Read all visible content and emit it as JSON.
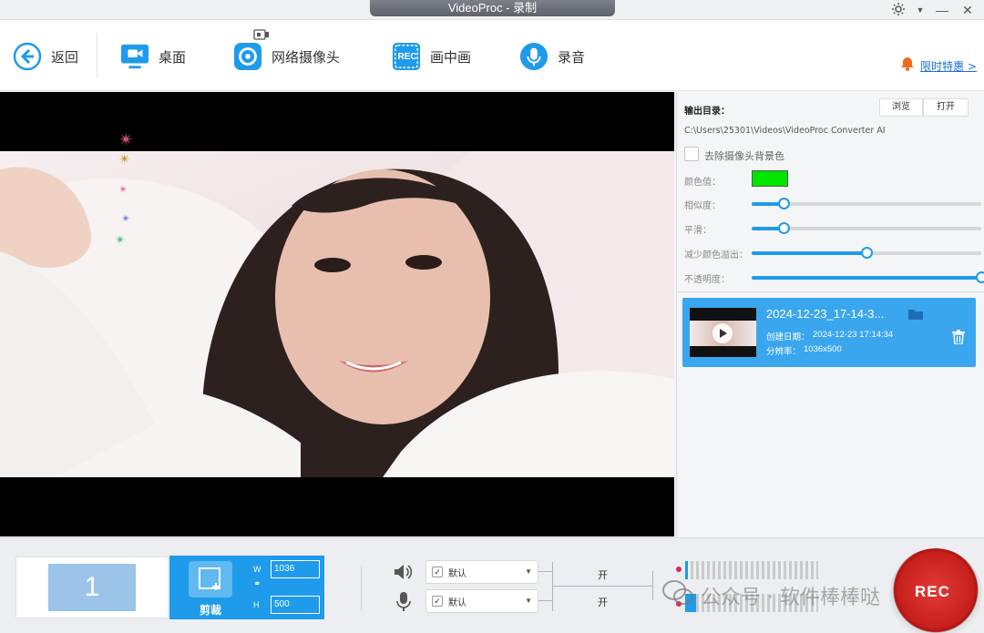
{
  "window": {
    "title": "VideoProc - 录制"
  },
  "toolbar": {
    "back_label": "返回",
    "desktop_label": "桌面",
    "webcam_label": "网络摄像头",
    "pip_label": "画中画",
    "audio_label": "录音",
    "rec_icon_text": "REC",
    "promo_label": "限时特惠 >"
  },
  "output": {
    "label": "输出目录：",
    "browse_label": "浏览",
    "open_label": "打开",
    "path": "C:\\Users\\25301\\Videos\\VideoProc Converter AI"
  },
  "chroma": {
    "remove_bg_label": "去除摄像头背景色",
    "remove_bg_checked": false,
    "color_label": "颜色值：",
    "color_value": "#00e600",
    "similarity_label": "相似度：",
    "similarity": 0.14,
    "smooth_label": "平滑：",
    "smooth": 0.14,
    "reduce_spill_label": "减少颜色溢出：",
    "reduce_spill": 0.5,
    "opacity_label": "不透明度：",
    "opacity": 1.0
  },
  "recording": {
    "filename": "2024-12-23_17-14-3...",
    "created_label": "创建日期：",
    "created_value": "2024-12-23 17:14:34",
    "resolution_label": "分辨率：",
    "resolution_value": "1036x500"
  },
  "bottom": {
    "screen_number": "1",
    "crop_label": "剪裁",
    "width_label": "W",
    "height_label": "H",
    "width_value": "1036",
    "height_value": "500",
    "speaker_device": "默认",
    "mic_device": "默认",
    "speaker_state": "开",
    "mic_state": "开",
    "speaker_level": 0.02,
    "mic_level": 0.08,
    "rec_label": "REC"
  },
  "watermark": {
    "text": "公众号 · 软件棒棒哒"
  },
  "colors": {
    "accent": "#1e9bea",
    "record_red": "#d42a26",
    "promo_bell": "#f06a1f"
  }
}
